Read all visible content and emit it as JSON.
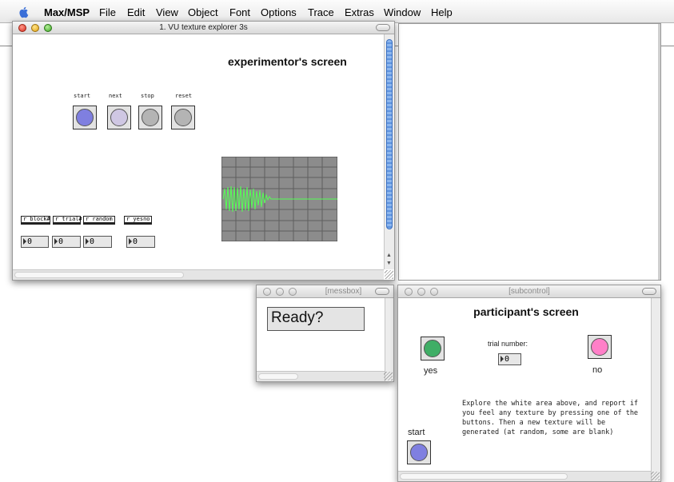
{
  "menubar": {
    "app": "Max/MSP",
    "items": [
      "File",
      "Edit",
      "View",
      "Object",
      "Font",
      "Options",
      "Trace",
      "Extras",
      "Window",
      "Help"
    ]
  },
  "windows": {
    "main": {
      "title": "1. VU texture explorer 3s",
      "heading": "experimentor's screen",
      "buttons": [
        {
          "label": "start",
          "color": "#7f7fe0"
        },
        {
          "label": "next",
          "color": "#cfc7e3"
        },
        {
          "label": "stop",
          "color": "#b4b4b4"
        },
        {
          "label": "reset",
          "color": "#b4b4b4"
        }
      ],
      "receivers": [
        "r block#",
        "r trial#",
        "r random",
        "r yesno"
      ],
      "numbers": [
        "0",
        "0",
        "0",
        "0"
      ]
    },
    "messbox": {
      "title": "[messbox]",
      "message": "Ready?"
    },
    "subcontrol": {
      "title": "[subcontrol]",
      "heading": "participant's screen",
      "yes_label": "yes",
      "no_label": "no",
      "trial_label": "trial number:",
      "trial_value": "0",
      "instructions": [
        "Explore the white area above, and report if",
        "you feel any texture by pressing one of the",
        "buttons. Then a new texture will be",
        "generated (at random, some are blank)"
      ],
      "start_label": "start",
      "yes_color": "#3fae66",
      "no_color": "#ff7fc8",
      "start_color": "#7f7fe0"
    }
  }
}
